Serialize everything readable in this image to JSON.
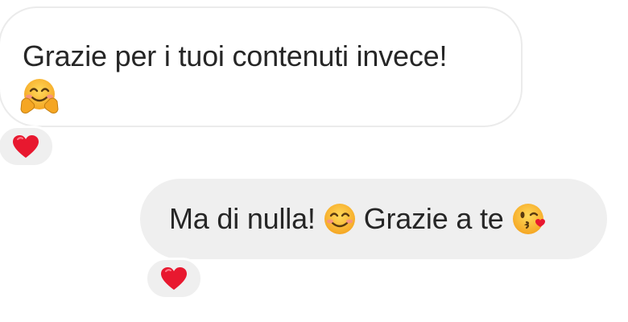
{
  "messages": [
    {
      "direction": "incoming",
      "text": "Grazie per i tuoi contenuti invece!",
      "emoji": "hugging-face-icon",
      "reaction": "red-heart-icon"
    },
    {
      "direction": "outgoing",
      "text_part1": "Ma di nulla!",
      "emoji1": "smiling-face-icon",
      "text_part2": "Grazie a te",
      "emoji2": "face-blowing-kiss-icon",
      "reaction": "red-heart-icon"
    }
  ],
  "colors": {
    "outgoing_bubble": "#efefef",
    "incoming_border": "#ebebeb",
    "text": "#262626",
    "heart": "#e8182f",
    "emoji_yellow": "#f9bd2e"
  }
}
